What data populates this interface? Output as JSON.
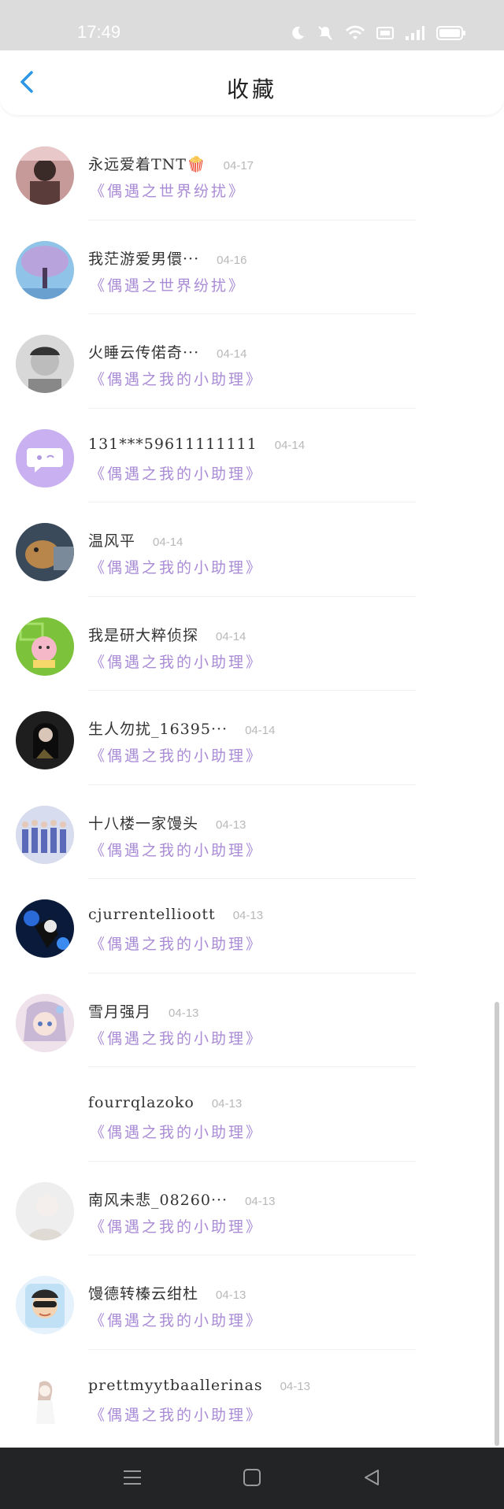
{
  "status_bar": {
    "time": "17:49"
  },
  "header": {
    "title": "收藏"
  },
  "items": [
    {
      "name": "永远爱着TNT🍿",
      "date": "04-17",
      "source": "《偶遇之世界纷扰》"
    },
    {
      "name": "我茫游爱男儇···",
      "date": "04-16",
      "source": "《偶遇之世界纷扰》"
    },
    {
      "name": "火睡云传偌奇···",
      "date": "04-14",
      "source": "《偶遇之我的小助理》"
    },
    {
      "name": "131***59611111111",
      "date": "04-14",
      "source": "《偶遇之我的小助理》"
    },
    {
      "name": "温风平",
      "date": "04-14",
      "source": "《偶遇之我的小助理》"
    },
    {
      "name": "我是研大粹侦探",
      "date": "04-14",
      "source": "《偶遇之我的小助理》"
    },
    {
      "name": "生人勿扰_16395···",
      "date": "04-14",
      "source": "《偶遇之我的小助理》"
    },
    {
      "name": "十八楼一家馒头",
      "date": "04-13",
      "source": "《偶遇之我的小助理》"
    },
    {
      "name": "cjurrentellioott",
      "date": "04-13",
      "source": "《偶遇之我的小助理》"
    },
    {
      "name": "雪月强月",
      "date": "04-13",
      "source": "《偶遇之我的小助理》"
    },
    {
      "name": "fourrqlazoko",
      "date": "04-13",
      "source": "《偶遇之我的小助理》"
    },
    {
      "name": "南风未悲_08260···",
      "date": "04-13",
      "source": "《偶遇之我的小助理》"
    },
    {
      "name": "馒德转榛云绀杜",
      "date": "04-13",
      "source": "《偶遇之我的小助理》"
    },
    {
      "name": "prettmyytbaallerinas",
      "date": "04-13",
      "source": "《偶遇之我的小助理》"
    }
  ],
  "colors": {
    "accent": "#2b96e6",
    "source_text": "#a98bd6",
    "date_text": "#b8b8b8",
    "nav_bar": "#222426",
    "status_bar": "#dcdcdc"
  }
}
